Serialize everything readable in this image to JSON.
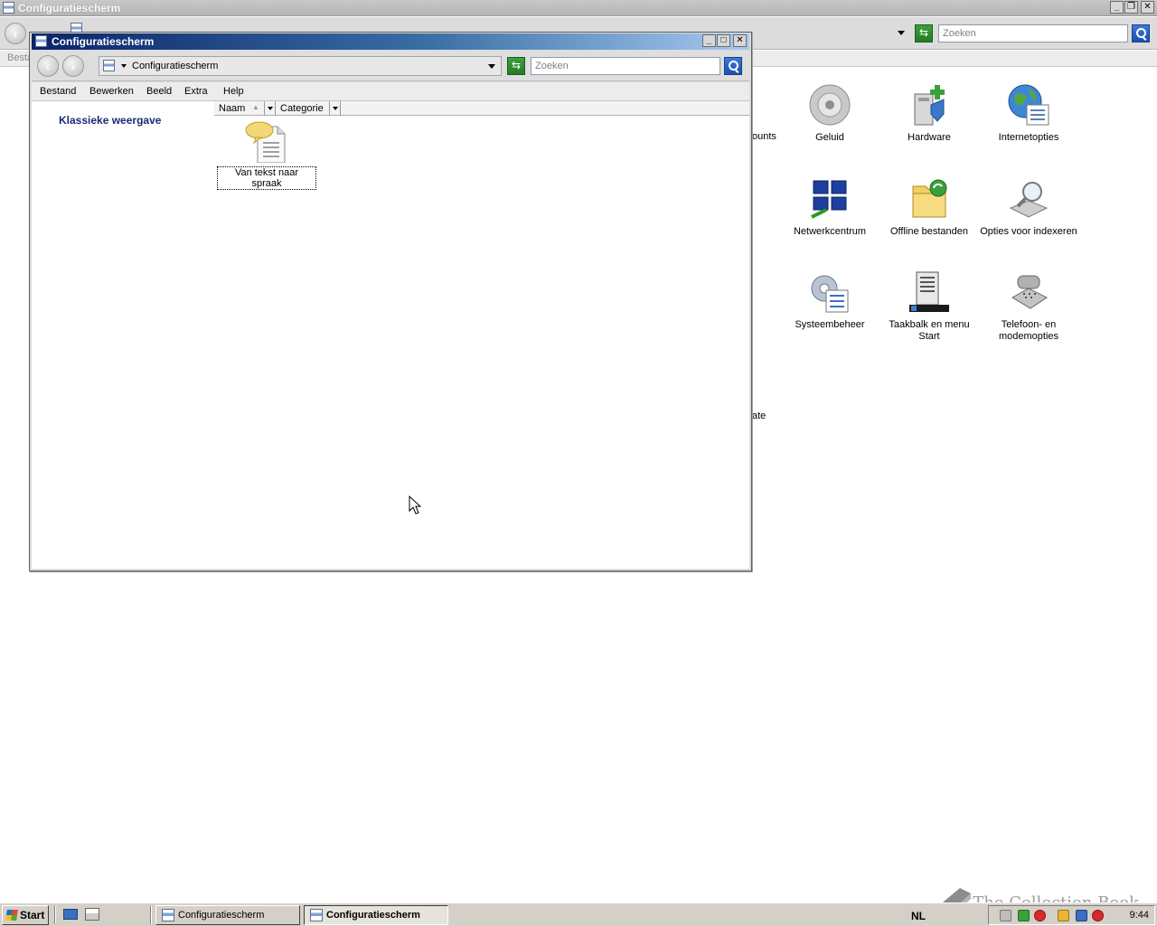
{
  "background_window": {
    "title": "Configuratiescherm",
    "search_placeholder": "Zoeken",
    "menu_first_partial": "Besta",
    "partial_labels": [
      "ounts",
      "ate"
    ],
    "items": [
      {
        "label": "Geluid",
        "icon": "speaker-icon"
      },
      {
        "label": "Hardware",
        "icon": "hardware-icon"
      },
      {
        "label": "Internetopties",
        "icon": "globe-icon"
      },
      {
        "label": "Netwerkcentrum",
        "icon": "network-icon"
      },
      {
        "label": "Offline bestanden",
        "icon": "folder-sync-icon"
      },
      {
        "label": "Opties voor indexeren",
        "icon": "index-icon"
      },
      {
        "label": "Systeembeheer",
        "icon": "admin-tools-icon"
      },
      {
        "label": "Taakbalk en menu Start",
        "icon": "taskbar-icon"
      },
      {
        "label": "Telefoon- en modemopties",
        "icon": "phone-icon"
      }
    ]
  },
  "foreground_window": {
    "title": "Configuratiescherm",
    "address": "Configuratiescherm",
    "search_placeholder": "Zoeken",
    "menu": [
      "Bestand",
      "Bewerken",
      "Beeld",
      "Extra",
      "Help"
    ],
    "sidebar_link": "Klassieke weergave",
    "columns": [
      "Naam",
      "Categorie"
    ],
    "item": {
      "label": "Van tekst naar spraak",
      "icon": "speech-document-icon"
    }
  },
  "taskbar": {
    "start_label": "Start",
    "tasks": [
      {
        "label": "Configuratiescherm",
        "active": false
      },
      {
        "label": "Configuratiescherm",
        "active": true
      }
    ],
    "language": "NL",
    "clock": "9:44"
  },
  "watermark": "The Collection Book",
  "colors": {
    "title_active_start": "#0a246a",
    "title_active_end": "#a6caf0",
    "link": "#1a2b77",
    "taskbar": "#d4d0c8"
  }
}
